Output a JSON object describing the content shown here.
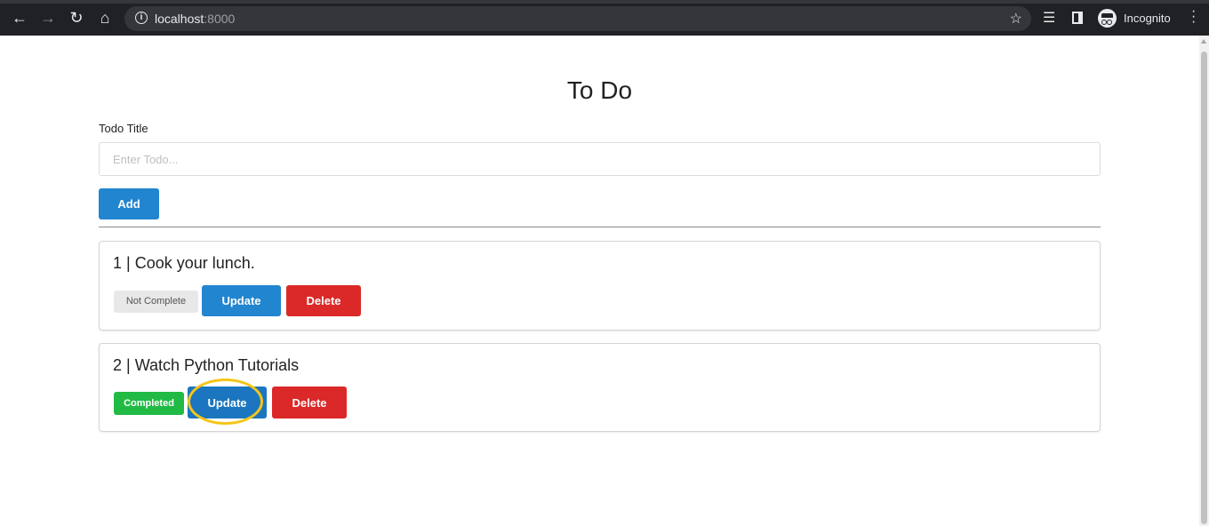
{
  "browser": {
    "url_host": "localhost",
    "url_port": ":8000",
    "profile_label": "Incognito",
    "icons": {
      "back": "arrow-left-icon",
      "forward": "arrow-right-icon",
      "reload": "reload-icon",
      "home": "home-icon",
      "info": "info-icon",
      "bookmark": "star-icon",
      "media": "media-queue-icon",
      "sidepanel": "side-panel-icon",
      "menu": "kebab-menu-icon"
    }
  },
  "page": {
    "title": "To Do",
    "form": {
      "label": "Todo Title",
      "placeholder": "Enter Todo...",
      "value": "",
      "add_label": "Add"
    },
    "todos": [
      {
        "header": "1 | Cook your lunch.",
        "status": "Not Complete",
        "completed": false,
        "update_label": "Update",
        "delete_label": "Delete"
      },
      {
        "header": "2 | Watch Python Tutorials",
        "status": "Completed",
        "completed": true,
        "update_label": "Update",
        "delete_label": "Delete"
      }
    ]
  },
  "colors": {
    "primary": "#2185d0",
    "danger": "#db2828",
    "success": "#21ba45",
    "highlight": "#f5c518"
  }
}
